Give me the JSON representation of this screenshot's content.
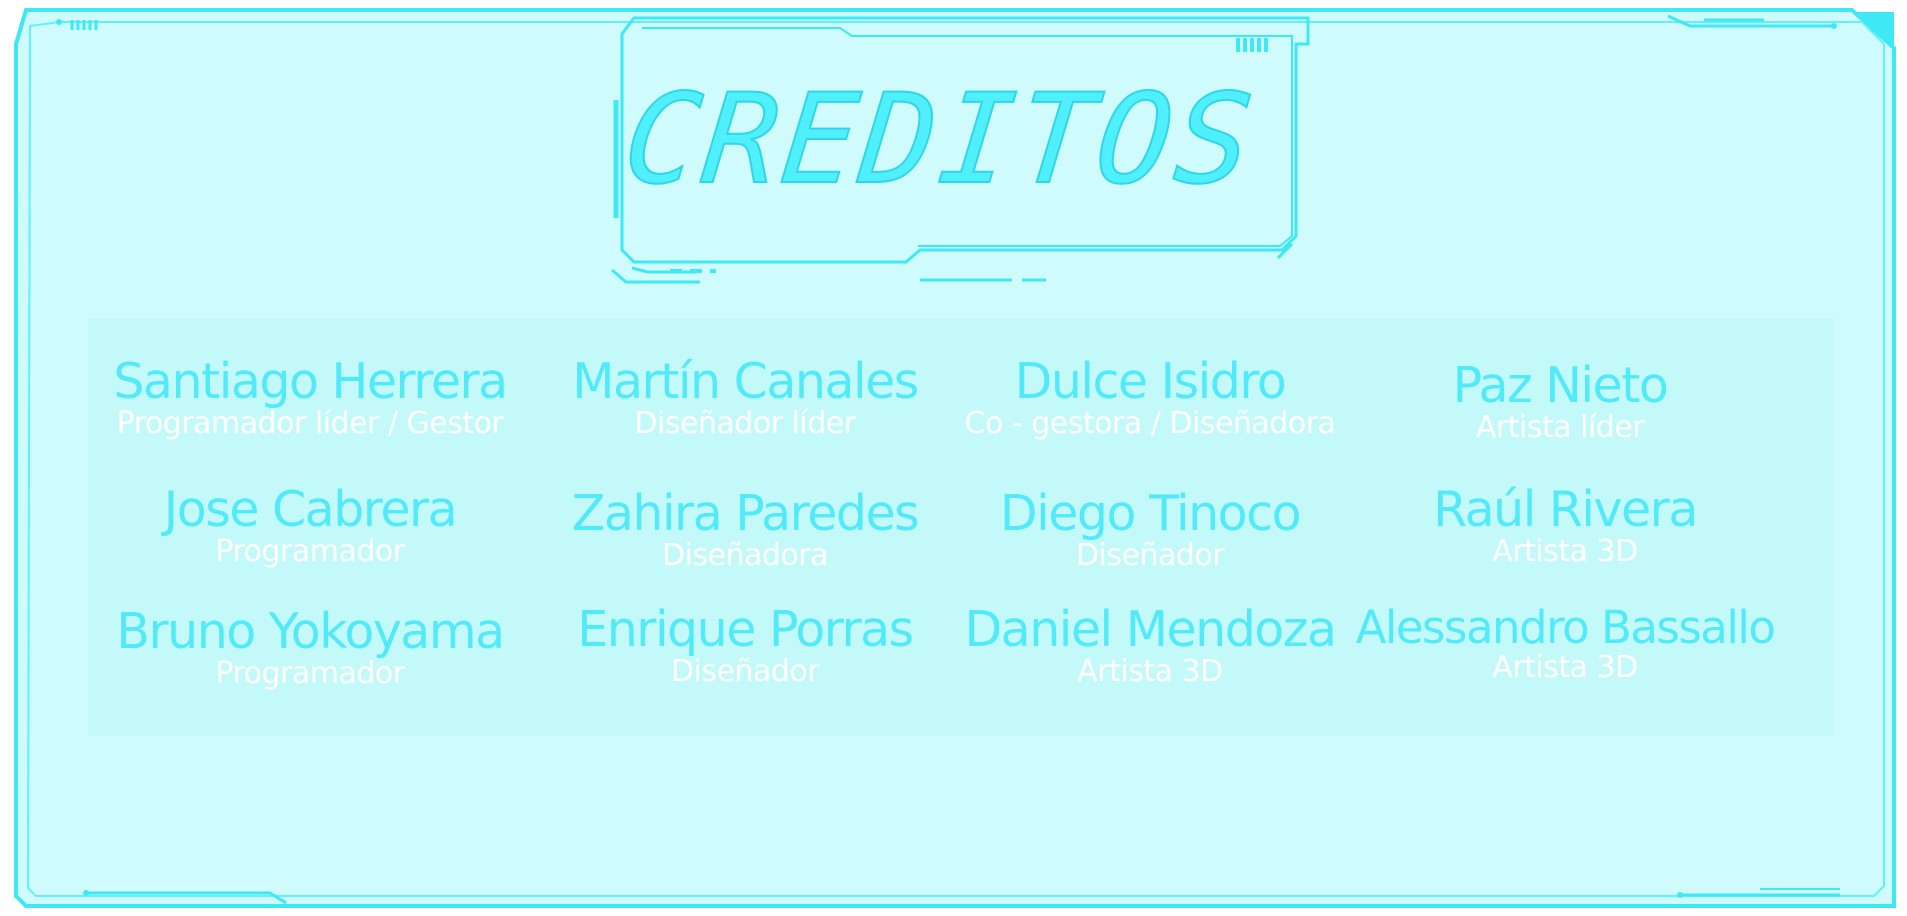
{
  "screen": {
    "title": "CREDITOS",
    "colors": {
      "background": "#cffbfc",
      "accent": "#4ff0fc",
      "frame": "#3ee8f4",
      "panel": "#c4f9fa",
      "role_text": "#ffffff"
    }
  },
  "credits": [
    {
      "name": "Santiago Herrera",
      "role": "Programador líder / Gestor"
    },
    {
      "name": "Martín Canales",
      "role": "Diseñador líder"
    },
    {
      "name": "Dulce Isidro",
      "role": "Co - gestora / Diseñadora"
    },
    {
      "name": "Paz Nieto",
      "role": "Artista líder"
    },
    {
      "name": "Jose Cabrera",
      "role": "Programador"
    },
    {
      "name": "Zahira Paredes",
      "role": "Diseñadora"
    },
    {
      "name": "Diego Tinoco",
      "role": "Diseñador"
    },
    {
      "name": "Raúl Rivera",
      "role": "Artista 3D"
    },
    {
      "name": "Bruno Yokoyama",
      "role": "Programador"
    },
    {
      "name": "Enrique Porras",
      "role": "Diseñador"
    },
    {
      "name": "Daniel Mendoza",
      "role": "Artista 3D"
    },
    {
      "name": "Alessandro Bassallo",
      "role": "Artista 3D"
    }
  ]
}
